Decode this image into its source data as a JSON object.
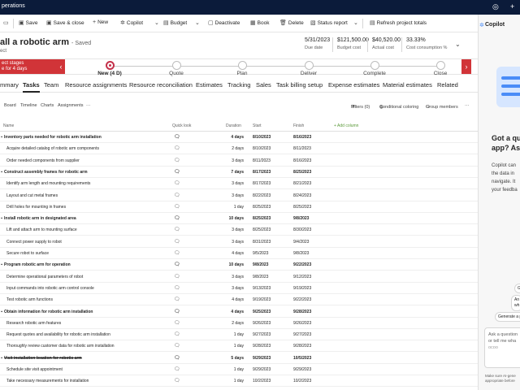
{
  "appbar": {
    "title": "perations"
  },
  "commands": {
    "save": "Save",
    "save_close": "Save & close",
    "new": "New",
    "copilot": "Copilot",
    "budget": "Budget",
    "deactivate": "Deactivate",
    "book": "Book",
    "delete": "Delete",
    "status_report": "Status report",
    "refresh": "Refresh project totals"
  },
  "header": {
    "title": "all a robotic arm",
    "saved": "- Saved",
    "subtitle": "ect",
    "metrics": [
      {
        "value": "5/31/2023",
        "label": "Due date"
      },
      {
        "value": "$121,500.00",
        "label": "Budget cost"
      },
      {
        "value": "$40,520.00",
        "label": "Actual cost"
      },
      {
        "value": "33.33%",
        "label": "Cost consumption %"
      }
    ]
  },
  "bpf": {
    "alert_line1": "ect stages",
    "alert_line2": "e for 4 days",
    "stages": [
      "New (4 D)",
      "Quote",
      "Plan",
      "Deliver",
      "Complete",
      "Close"
    ]
  },
  "tabs": [
    "mmary",
    "Tasks",
    "Team",
    "Resource assignments",
    "Resource reconciliation",
    "Estimates",
    "Tracking",
    "Sales",
    "Task billing setup",
    "Expense estimates",
    "Material estimates",
    "Related"
  ],
  "grid_toolbar": {
    "views": [
      "Board",
      "Timeline",
      "Charts",
      "Assignments"
    ],
    "more": "···",
    "filters": "Filters (0)",
    "conditional": "Conditional coloring",
    "group": "Group members",
    "overflow": "···"
  },
  "grid": {
    "headers": {
      "name": "Name",
      "quick": "Quick look",
      "duration": "Duration",
      "start": "Start",
      "finish": "Finish",
      "add": "+ Add column"
    },
    "rows": [
      {
        "name": "Inventory parts needed for robotic arm installation",
        "dur": "4 days",
        "start": "8/10/2023",
        "finish": "8/16/2023",
        "summary": true
      },
      {
        "name": "Acquire detailed catalog of robotic arm components",
        "dur": "2 days",
        "start": "8/10/2023",
        "finish": "8/11/2023"
      },
      {
        "name": "Order needed components from supplier",
        "dur": "3 days",
        "start": "8/11/2023",
        "finish": "8/16/2023"
      },
      {
        "name": "Construct assembly frames for robotic arm",
        "dur": "7 days",
        "start": "8/17/2023",
        "finish": "8/25/2023",
        "summary": true
      },
      {
        "name": "Identify arm length and mounting requirements",
        "dur": "3 days",
        "start": "8/17/2023",
        "finish": "8/21/2023"
      },
      {
        "name": "Layout and cut metal frames",
        "dur": "3 days",
        "start": "8/22/2023",
        "finish": "8/24/2023"
      },
      {
        "name": "Drill holes for mounting in frames",
        "dur": "1 day",
        "start": "8/25/2023",
        "finish": "8/25/2023"
      },
      {
        "name": "Install robotic arm in designated area",
        "dur": "10 days",
        "start": "8/25/2023",
        "finish": "9/8/2023",
        "summary": true
      },
      {
        "name": "Lift and attach arm to mounting surface",
        "dur": "3 days",
        "start": "8/25/2023",
        "finish": "8/30/2023"
      },
      {
        "name": "Connect power supply to robot",
        "dur": "3 days",
        "start": "8/31/2023",
        "finish": "9/4/2023"
      },
      {
        "name": "Secure robot to surface",
        "dur": "4 days",
        "start": "9/5/2023",
        "finish": "9/8/2023"
      },
      {
        "name": "Program robotic arm for operation",
        "dur": "10 days",
        "start": "9/8/2023",
        "finish": "9/22/2023",
        "summary": true
      },
      {
        "name": "Determine operational parameters of robot",
        "dur": "3 days",
        "start": "9/8/2023",
        "finish": "9/12/2023"
      },
      {
        "name": "Input commands into robotic arm control console",
        "dur": "3 days",
        "start": "9/13/2023",
        "finish": "9/19/2023"
      },
      {
        "name": "Test robotic arm functions",
        "dur": "4 days",
        "start": "9/19/2023",
        "finish": "9/22/2023"
      },
      {
        "name": "Obtain information for robotic arm installation",
        "dur": "4 days",
        "start": "9/25/2023",
        "finish": "9/28/2023",
        "summary": true
      },
      {
        "name": "Research robotic arm features",
        "dur": "2 days",
        "start": "9/26/2023",
        "finish": "9/26/2023"
      },
      {
        "name": "Request quotes and availability for robotic arm installation",
        "dur": "1 day",
        "start": "9/27/2023",
        "finish": "9/27/2023"
      },
      {
        "name": "Thoroughly review customer data for robotic arm installation",
        "dur": "1 day",
        "start": "9/28/2023",
        "finish": "9/28/2023"
      },
      {
        "name": "Visit installation location for robotic arm",
        "dur": "5 days",
        "start": "9/29/2023",
        "finish": "10/5/2023",
        "summary": true,
        "struck": true
      },
      {
        "name": "Schedule site visit appointment",
        "dur": "1 day",
        "start": "9/29/2023",
        "finish": "9/29/2023"
      },
      {
        "name": "Take necessary measurements for installation",
        "dur": "1 day",
        "start": "10/2/2023",
        "finish": "10/2/2023"
      }
    ]
  },
  "copilot": {
    "title": "Copilot",
    "heading_1": "Got a qu",
    "heading_2": "app? Ask",
    "para": [
      "Copilot can",
      "the data in",
      "navigate. It",
      "your feedba"
    ],
    "chips": [
      "Gi",
      "An",
      "wh",
      "Generate a p"
    ],
    "input": [
      "Ask a question",
      "or tell me wha",
      "ᴏᴄᴏᴏ"
    ],
    "footer": [
      "Make sure AI-gene",
      "appropriate before"
    ]
  }
}
